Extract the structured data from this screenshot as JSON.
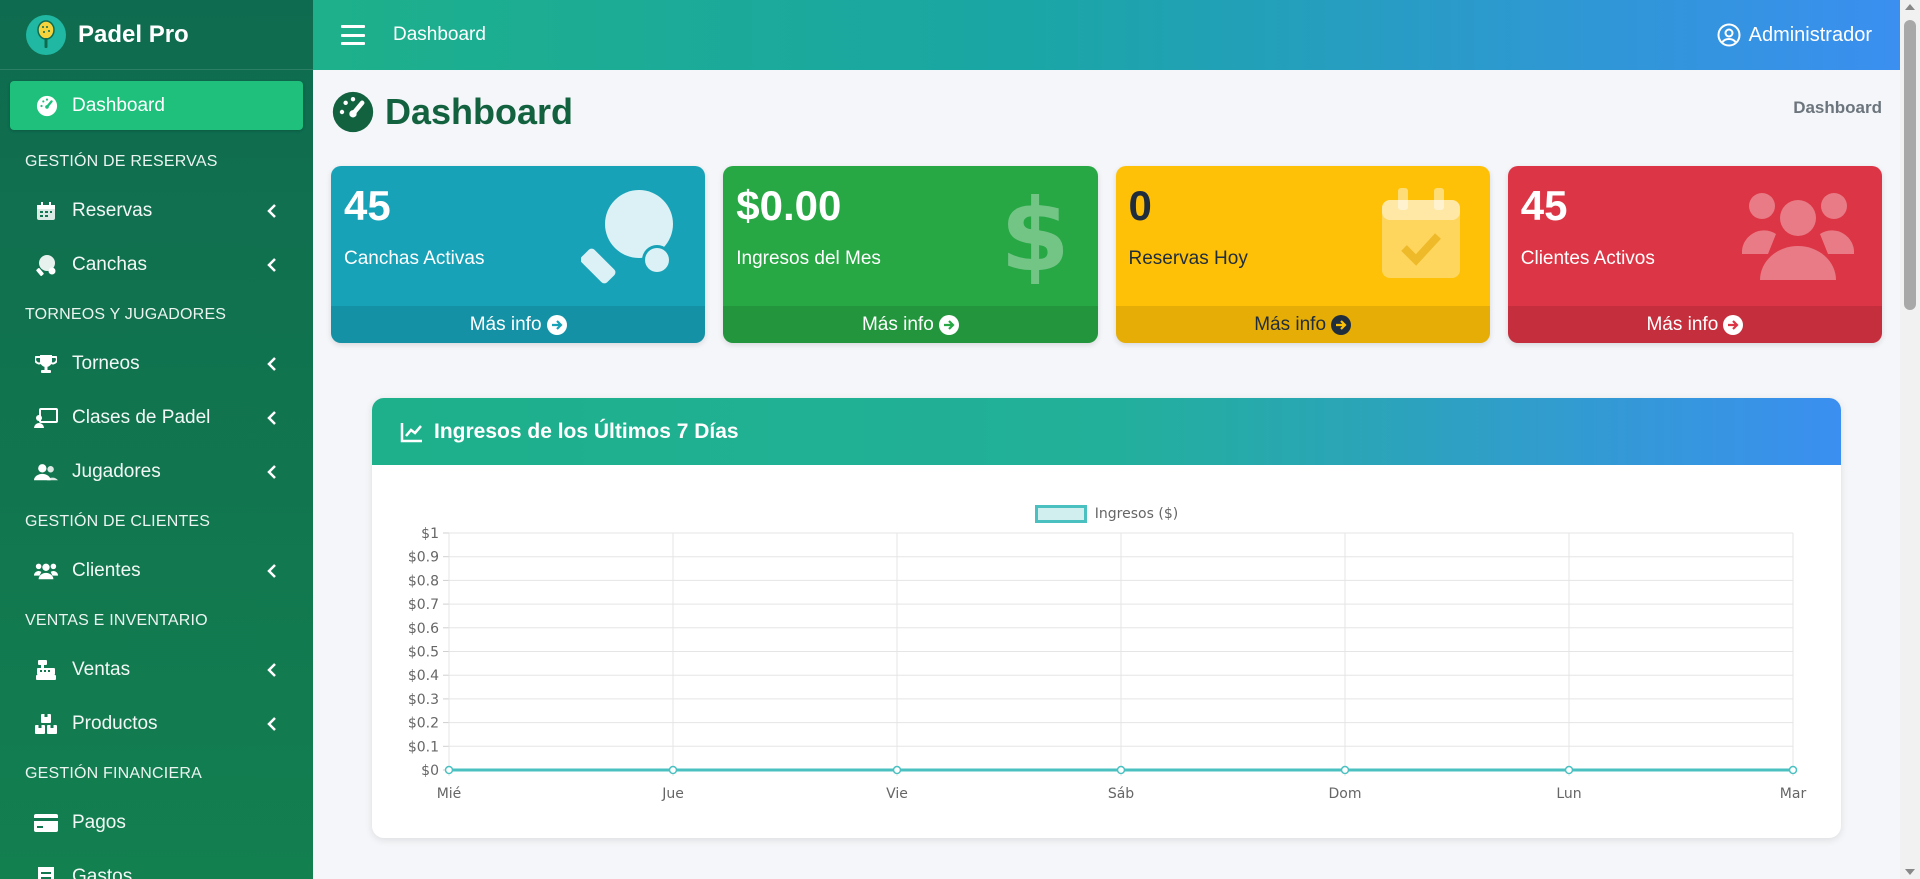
{
  "brand": {
    "name": "Padel Pro"
  },
  "sidebar": {
    "active": {
      "label": "Dashboard"
    },
    "sections": [
      {
        "header": "GESTIÓN DE RESERVAS",
        "items": [
          {
            "label": "Reservas",
            "icon": "calendar-icon"
          },
          {
            "label": "Canchas",
            "icon": "court-icon"
          }
        ]
      },
      {
        "header": "TORNEOS Y JUGADORES",
        "items": [
          {
            "label": "Torneos",
            "icon": "trophy-icon"
          },
          {
            "label": "Clases de Padel",
            "icon": "chalkboard-icon"
          },
          {
            "label": "Jugadores",
            "icon": "users-icon"
          }
        ]
      },
      {
        "header": "GESTIÓN DE CLIENTES",
        "items": [
          {
            "label": "Clientes",
            "icon": "group-icon"
          }
        ]
      },
      {
        "header": "VENTAS E INVENTARIO",
        "items": [
          {
            "label": "Ventas",
            "icon": "cash-register-icon"
          },
          {
            "label": "Productos",
            "icon": "boxes-icon"
          }
        ]
      },
      {
        "header": "GESTIÓN FINANCIERA",
        "items": [
          {
            "label": "Pagos",
            "icon": "credit-card-icon"
          },
          {
            "label": "Gastos",
            "icon": "receipt-icon"
          }
        ]
      }
    ]
  },
  "header": {
    "title": "Dashboard",
    "user": "Administrador"
  },
  "page": {
    "title": "Dashboard",
    "breadcrumb": "Dashboard"
  },
  "cards": [
    {
      "value": "45",
      "label": "Canchas Activas",
      "link": "Más info",
      "color": "#17a2b8"
    },
    {
      "value": "$0.00",
      "label": "Ingresos del Mes",
      "link": "Más info",
      "color": "#28a745"
    },
    {
      "value": "0",
      "label": "Reservas Hoy",
      "link": "Más info",
      "color": "#ffc107"
    },
    {
      "value": "45",
      "label": "Clientes Activos",
      "link": "Más info",
      "color": "#dc3545"
    }
  ],
  "chart_panel": {
    "title": "Ingresos de los Últimos 7 Días"
  },
  "chart_data": {
    "type": "line",
    "categories": [
      "Mié",
      "Jue",
      "Vie",
      "Sáb",
      "Dom",
      "Lun",
      "Mar"
    ],
    "series": [
      {
        "name": "Ingresos ($)",
        "values": [
          0,
          0,
          0,
          0,
          0,
          0,
          0
        ],
        "color": "#4bc0c0"
      }
    ],
    "ylim": [
      0,
      1
    ],
    "yticks": [
      "$0",
      "$0.1",
      "$0.2",
      "$0.3",
      "$0.4",
      "$0.5",
      "$0.6",
      "$0.7",
      "$0.8",
      "$0.9",
      "$1"
    ],
    "legend": "top",
    "grid": true
  }
}
